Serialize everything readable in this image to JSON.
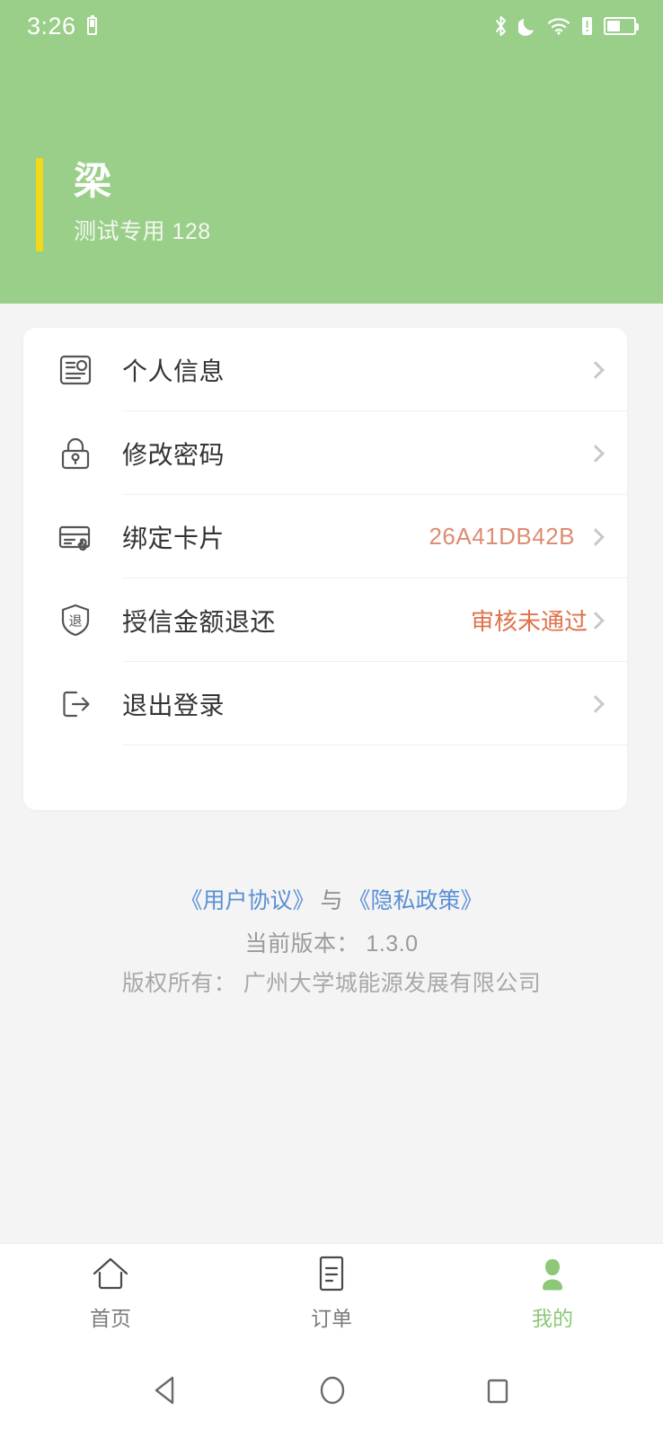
{
  "statusbar": {
    "time": "3:26",
    "icons": [
      "mini-battery-icon",
      "bluetooth-icon",
      "do-not-disturb-moon-icon",
      "wifi-icon",
      "vibrate-alert-icon",
      "battery-icon"
    ]
  },
  "header": {
    "user_name": "梁",
    "user_subtitle": "测试专用 128",
    "accent_color": "#F1D81B",
    "background_color": "#9ACF89"
  },
  "menu": {
    "items": [
      {
        "label": "个人信息",
        "icon": "id-card-icon",
        "value": ""
      },
      {
        "label": "修改密码",
        "icon": "lock-icon",
        "value": ""
      },
      {
        "label": "绑定卡片",
        "icon": "card-link-icon",
        "value": "26A41DB42B",
        "value_color": "#DE8C72"
      },
      {
        "label": "授信金额退还",
        "icon": "shield-refund-icon",
        "value": "审核未通过",
        "value_color": "#E0714B"
      },
      {
        "label": "退出登录",
        "icon": "logout-icon",
        "value": ""
      }
    ]
  },
  "footer": {
    "user_agreement": "《用户协议》",
    "conjunction": "与",
    "privacy_policy": "《隐私政策》",
    "version_line": "当前版本： 1.3.0",
    "copyright_line": "版权所有： 广州大学城能源发展有限公司"
  },
  "tabbar": {
    "items": [
      {
        "label": "首页",
        "icon": "home-icon",
        "active": false
      },
      {
        "label": "订单",
        "icon": "order-list-icon",
        "active": false
      },
      {
        "label": "我的",
        "icon": "person-icon",
        "active": true
      }
    ],
    "active_color": "#8CC878"
  },
  "navbar": {
    "back": "back-triangle-icon",
    "home": "home-circle-icon",
    "recents": "recents-square-icon"
  }
}
